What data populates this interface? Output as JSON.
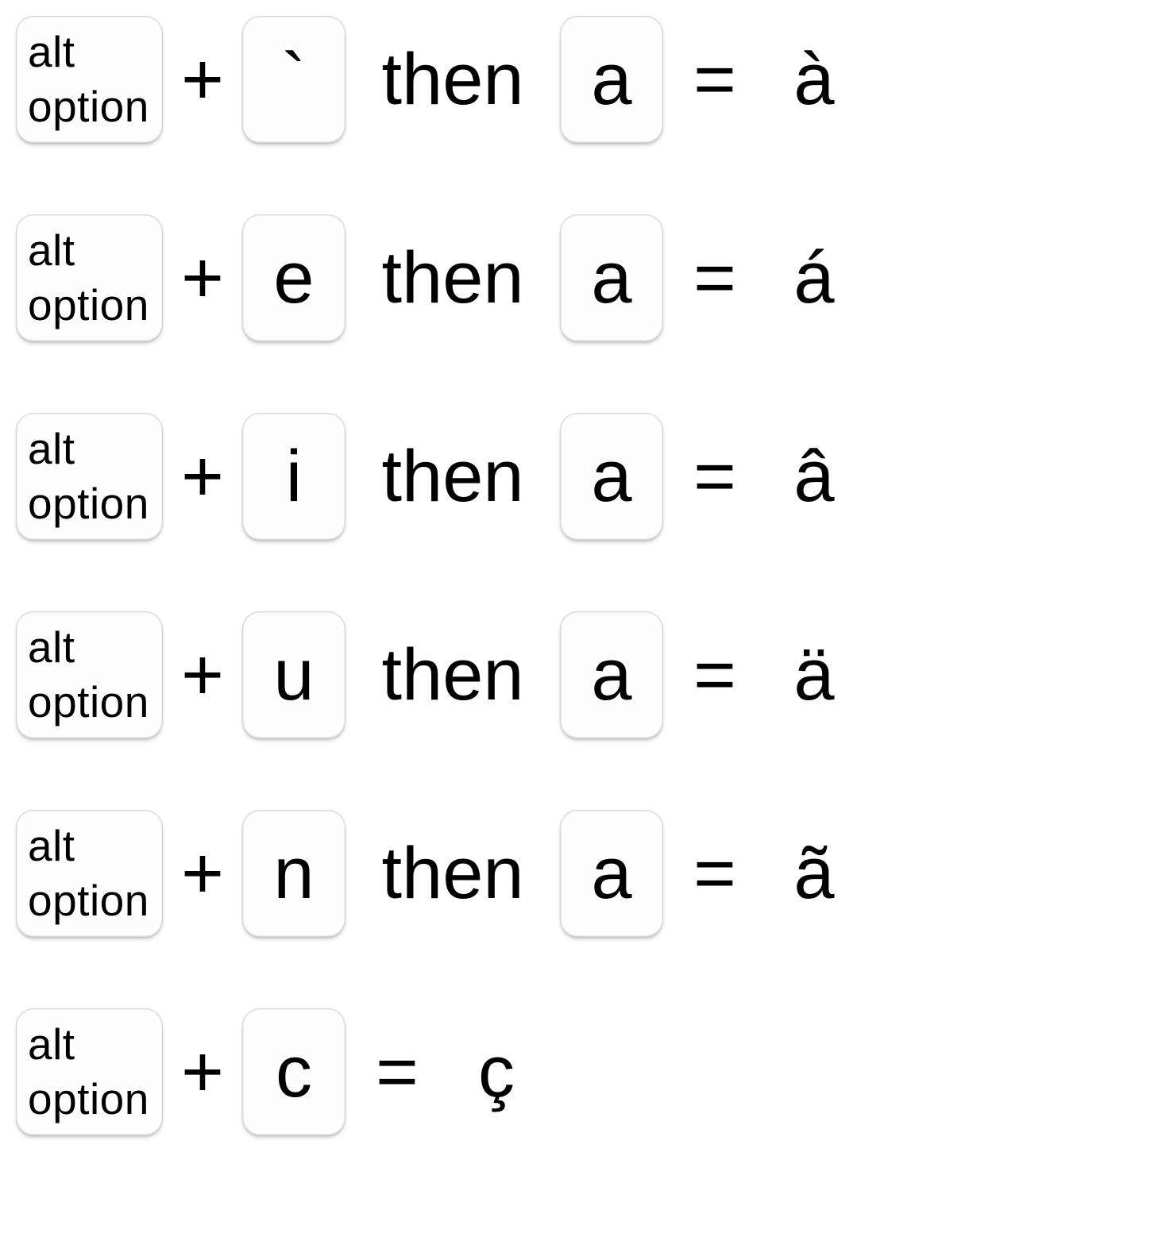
{
  "labels": {
    "alt": "alt",
    "option": "option",
    "plus": "+",
    "then": "then",
    "equals": "="
  },
  "rows": [
    {
      "modifier_key": "`",
      "has_then": true,
      "letter_key": "a",
      "result": "à"
    },
    {
      "modifier_key": "e",
      "has_then": true,
      "letter_key": "a",
      "result": "á"
    },
    {
      "modifier_key": "i",
      "has_then": true,
      "letter_key": "a",
      "result": "â"
    },
    {
      "modifier_key": "u",
      "has_then": true,
      "letter_key": "a",
      "result": "ä"
    },
    {
      "modifier_key": "n",
      "has_then": true,
      "letter_key": "a",
      "result": "ã"
    },
    {
      "modifier_key": "c",
      "has_then": false,
      "letter_key": "",
      "result": "ç"
    }
  ]
}
